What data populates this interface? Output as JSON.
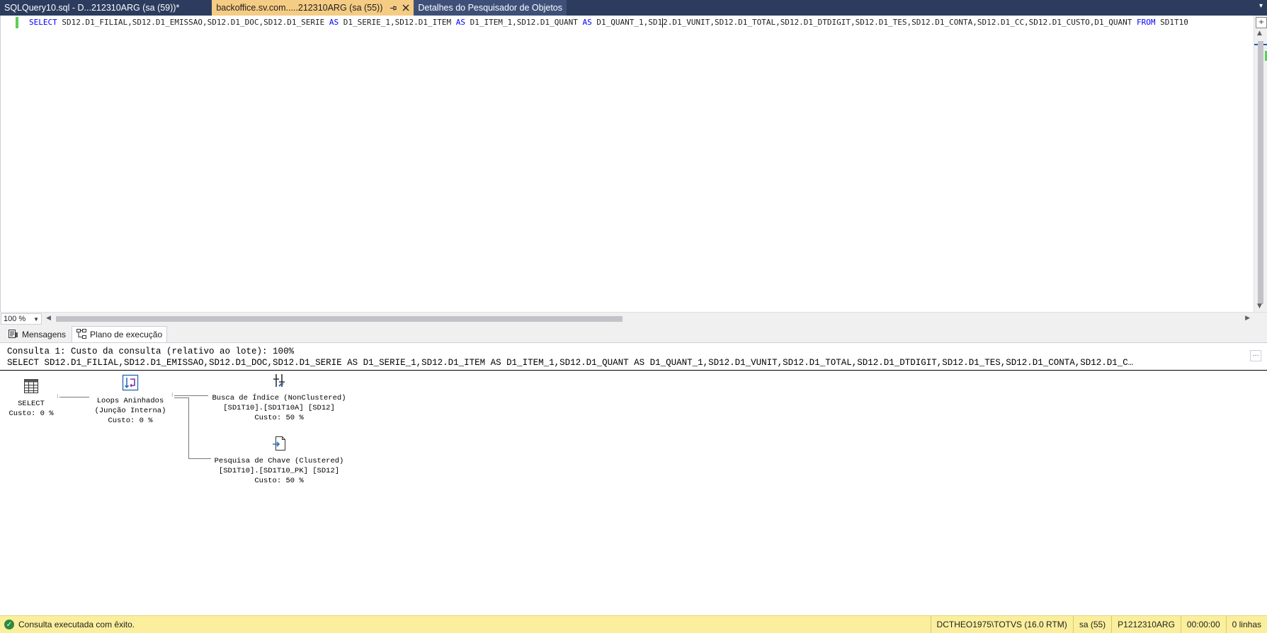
{
  "tabs": [
    {
      "label": "SQLQuery10.sql - D...212310ARG (sa (59))*",
      "state": "inactive"
    },
    {
      "label": "backoffice.sv.com.....212310ARG (sa (55))",
      "state": "active",
      "pin_icon": "pin-icon",
      "close_icon": "close-icon"
    },
    {
      "label": "Detalhes do Pesquisador de Objetos",
      "state": "inactive"
    }
  ],
  "editor": {
    "sql_line": {
      "p1": "SD12.D1_FILIAL,SD12.D1_EMISSAO,SD12.D1_DOC,SD12.D1_SERIE ",
      "kw_select": "SELECT",
      "kw_as": "AS",
      "p2": " D1_SERIE_1,SD12.D1_ITEM ",
      "p3": " D1_ITEM_1,SD12.D1_QUANT ",
      "p4": " D1_QUANT_1,SD1",
      "p4b": "2.D1_VUNIT,SD12.D1_TOTAL,SD12.D1_DTDIGIT,SD12.D1_TES,SD12.D1_CONTA,SD12.D1_CC,SD12.D1_CUSTO,D1_QUANT ",
      "kw_from": "FROM",
      "p5": " SD1T10"
    }
  },
  "zoom": {
    "value": "100 %"
  },
  "result_tabs": [
    {
      "label": "Mensagens",
      "icon": "messages-icon",
      "active": false
    },
    {
      "label": "Plano de execução",
      "icon": "execution-plan-icon",
      "active": true
    }
  ],
  "plan": {
    "header_line1": "Consulta 1: Custo da consulta (relativo ao lote): 100%",
    "header_line2": "SELECT SD12.D1_FILIAL,SD12.D1_EMISSAO,SD12.D1_DOC,SD12.D1_SERIE AS D1_SERIE_1,SD12.D1_ITEM AS D1_ITEM_1,SD12.D1_QUANT AS D1_QUANT_1,SD12.D1_VUNIT,SD12.D1_TOTAL,SD12.D1_DTDIGIT,SD12.D1_TES,SD12.D1_CONTA,SD12.D1_C…",
    "nodes": [
      {
        "icon": "select-icon",
        "lines": [
          "SELECT",
          "Custo: 0 %"
        ]
      },
      {
        "icon": "nested-loops-icon",
        "lines": [
          "Loops Aninhados",
          "(Junção Interna)",
          "Custo: 0 %"
        ]
      },
      {
        "icon": "index-seek-icon",
        "lines": [
          "Busca de Índice (NonClustered)",
          "[SD1T10].[SD1T10A] [SD12]",
          "Custo: 50 %"
        ]
      },
      {
        "icon": "key-lookup-icon",
        "lines": [
          "Pesquisa de Chave (Clustered)",
          "[SD1T10].[SD1T10_PK] [SD12]",
          "Custo: 50 %"
        ]
      }
    ]
  },
  "status": {
    "message": "Consulta executada com êxito.",
    "server": "DCTHEO1975\\TOTVS (16.0 RTM)",
    "user": "sa (55)",
    "database": "P1212310ARG",
    "elapsed": "00:00:00",
    "rows": "0 linhas",
    "ok_icon": "success-check-icon"
  },
  "colors": {
    "tab_bg": "#2b3c5e",
    "active_tab": "#f5cc84",
    "status_bg": "#fbef9d",
    "keyword": "#0000ff"
  }
}
